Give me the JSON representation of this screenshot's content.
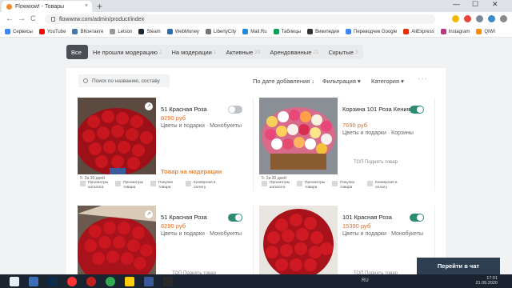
{
  "browser": {
    "tab_title": "Flowwow! - Товары",
    "url": "flowwow.com/admin/product/index",
    "new_tab": "+",
    "minimize": "—",
    "maximize": "☐",
    "close": "✕",
    "tab_close": "×",
    "back": "←",
    "forward": "→",
    "reload": "C"
  },
  "bookmarks": [
    {
      "label": "Сервисы",
      "color": "#4285f4"
    },
    {
      "label": "YouTube",
      "color": "#ff0000"
    },
    {
      "label": "ВКонтакте",
      "color": "#4a76a8"
    },
    {
      "label": "Letson",
      "color": "#999999"
    },
    {
      "label": "Steam",
      "color": "#1b2838"
    },
    {
      "label": "WebMoney",
      "color": "#2a6db0"
    },
    {
      "label": "LibertyCity",
      "color": "#777777"
    },
    {
      "label": "Mail.Ru",
      "color": "#168de2"
    },
    {
      "label": "Таблицы",
      "color": "#0f9d58"
    },
    {
      "label": "Википедия",
      "color": "#333333"
    },
    {
      "label": "Переводчик Google",
      "color": "#4285f4"
    },
    {
      "label": "AliExpress",
      "color": "#e62e04"
    },
    {
      "label": "Instagram",
      "color": "#c13584"
    },
    {
      "label": "QIWI",
      "color": "#ff8c00"
    }
  ],
  "filters": [
    {
      "label": "Все",
      "count": ""
    },
    {
      "label": "Не прошли модерацию",
      "count": "2"
    },
    {
      "label": "На модерации",
      "count": "1"
    },
    {
      "label": "Активные",
      "count": "33"
    },
    {
      "label": "Арендованные",
      "count": "21"
    },
    {
      "label": "Скрытые",
      "count": "3"
    }
  ],
  "toolbar": {
    "search_placeholder": "Поиск по названию, составу",
    "sort_label": "По дате добавления ↓",
    "filter_label": "Фильтрация ▾",
    "category_label": "Категория ▾",
    "more": "···"
  },
  "cards": [
    {
      "name": "51 Красная Роза",
      "price": "8290 руб",
      "category": "Цветы и подарки · Монобукеты",
      "enabled": false,
      "status": "Товар на модерации",
      "days": "5: За 30 дней",
      "stats": [
        "Просмотры каталога",
        "Просмотры товара",
        "Покупки товара",
        "Конверсия в оплату"
      ]
    },
    {
      "name": "Корзина 101 Роза Кения",
      "price": "7690 руб",
      "category": "Цветы и подарки · Корзины",
      "enabled": true,
      "boost": "ТОП   Поднять товар",
      "days": "5: За 30 дней",
      "stats": [
        "Просмотры каталога",
        "Просмотры товара",
        "Покупки товара",
        "Конверсия в оплату"
      ]
    },
    {
      "name": "51 Красная Роза",
      "price": "8290 руб",
      "category": "Цветы и подарки · Монобукеты",
      "enabled": true,
      "boost": "ТОП   Поднять товар"
    },
    {
      "name": "101 Красная Роза",
      "price": "15390 руб",
      "category": "Цветы и подарки · Монобукеты",
      "enabled": true,
      "boost": "ТОП   Поднять товар"
    }
  ],
  "chat_button": "Перейти в чат",
  "taskbar": {
    "lang": "RU",
    "time": "17:01",
    "date": "21.09.2020"
  },
  "colors": {
    "accent_price": "#e0702a",
    "toggle_on": "#2e8b72",
    "moderation": "#e8883a"
  }
}
